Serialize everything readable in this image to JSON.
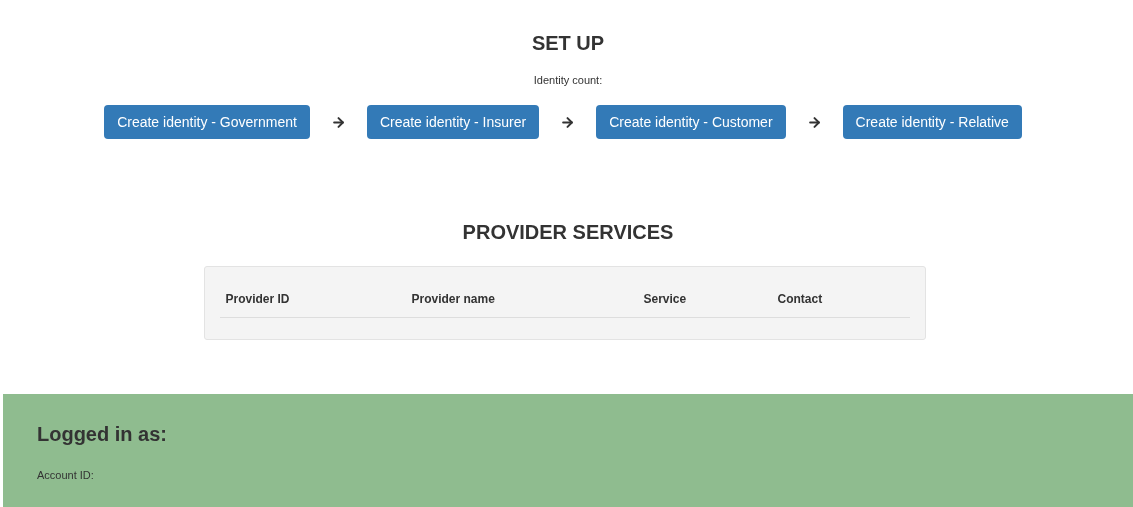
{
  "setup": {
    "title": "SET UP",
    "identity_count_label": "Identity count:",
    "buttons": [
      {
        "label": "Create identity - Government"
      },
      {
        "label": "Create identity - Insurer"
      },
      {
        "label": "Create identity - Customer"
      },
      {
        "label": "Create identity - Relative"
      }
    ]
  },
  "provider_services": {
    "title": "PROVIDER SERVICES",
    "table": {
      "columns": [
        "Provider ID",
        "Provider name",
        "Service",
        "Contact"
      ]
    }
  },
  "footer": {
    "title": "Logged in as:",
    "account_label": "Account ID:"
  }
}
